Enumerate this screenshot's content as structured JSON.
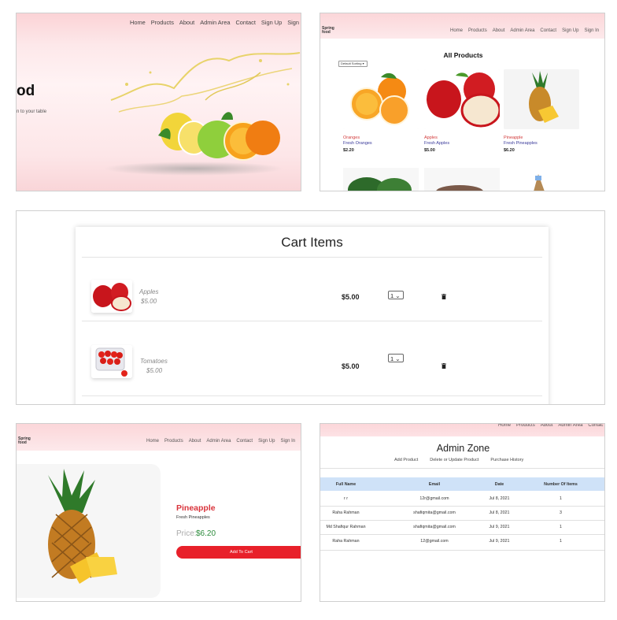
{
  "panel_home": {
    "nav": [
      "Home",
      "Products",
      "About",
      "Admin Area",
      "Contact",
      "Sign Up",
      "Sign"
    ],
    "hero_title": "od",
    "hero_subtitle": "n to your table"
  },
  "panel_products": {
    "brand": [
      "Spring",
      "food"
    ],
    "nav": [
      "Home",
      "Products",
      "About",
      "Admin Area",
      "Contact",
      "Sign Up",
      "Sign In"
    ],
    "title": "All Products",
    "sort_label": "Default Sorting ▾",
    "items": [
      {
        "name": "Oranges",
        "desc": "Fresh Oranges",
        "price": "$2.20"
      },
      {
        "name": "Apples",
        "desc": "Fresh Apples",
        "price": "$5.00"
      },
      {
        "name": "Pineapple",
        "desc": "Fresh Pineapples",
        "price": "$6.20"
      }
    ]
  },
  "panel_cart": {
    "title": "Cart Items",
    "items": [
      {
        "name": "Apples",
        "price": "$5.00",
        "total": "$5.00",
        "qty": "1"
      },
      {
        "name": "Tomatoes",
        "price": "$5.00",
        "total": "$5.00",
        "qty": "1"
      }
    ]
  },
  "panel_detail": {
    "brand": [
      "Spring",
      "food"
    ],
    "nav": [
      "Home",
      "Products",
      "About",
      "Admin Area",
      "Contact",
      "Sign Up",
      "Sign In"
    ],
    "name": "Pineapple",
    "desc": "Fresh Pineapples",
    "price_label": "Price:",
    "price": "$6.20",
    "button": "Add To Cart"
  },
  "panel_admin": {
    "nav": [
      "Home",
      "Products",
      "About",
      "Admin Area",
      "Contac"
    ],
    "title": "Admin Zone",
    "tabs": [
      "Add Product",
      "Delete or Update Product",
      "Purchase History"
    ],
    "columns": [
      "Full Name",
      "Email",
      "Date",
      "Number Of Items"
    ],
    "rows": [
      [
        "r r",
        "12r@gmail.com",
        "Jul 8, 2021",
        "1"
      ],
      [
        "Raha Rahman",
        "shafiqmita@gmail.com",
        "Jul 8, 2021",
        "3"
      ],
      [
        "Md Shafiqur Rahman",
        "shafiqmita@gmail.com",
        "Jul 9, 2021",
        "1"
      ],
      [
        "Raha Rahman",
        "12@gmail.com",
        "Jul 9, 2021",
        "1"
      ]
    ]
  },
  "colors": {
    "header_pink": "#fbd6d9",
    "accent_red": "#e8202a",
    "table_header": "#cfe2f8",
    "price_green": "#2a8a3a"
  }
}
